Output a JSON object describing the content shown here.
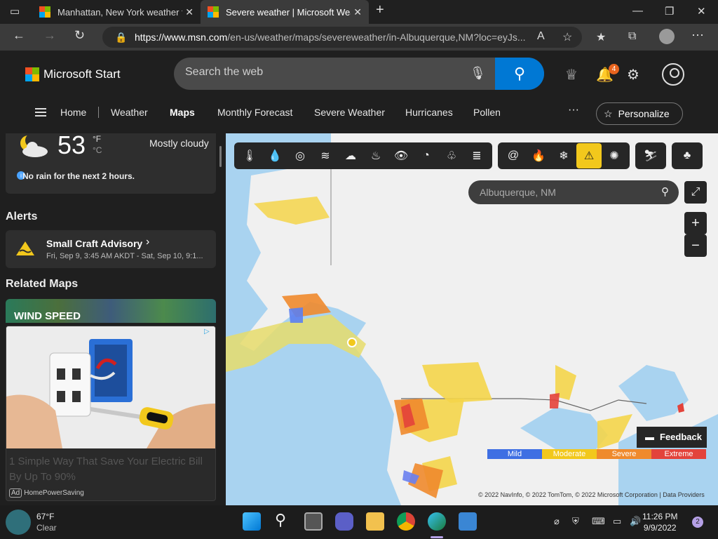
{
  "tabs": [
    {
      "title": "Manhattan, New York weather forecast",
      "close": "✕"
    },
    {
      "title": "Severe weather | Microsoft Weather",
      "close": "✕"
    }
  ],
  "newtab": "+",
  "window": {
    "minimize": "—",
    "maximize": "❐",
    "close": "✕"
  },
  "address": {
    "host": "https://www.msn.com",
    "path": "/en-us/weather/maps/severeweather/in-Albuquerque,NM?loc=eyJs..."
  },
  "site": {
    "brand": "Microsoft Start",
    "search_placeholder": "Search the web",
    "notifications": "4",
    "nav": [
      "Home",
      "Weather",
      "Maps",
      "Monthly Forecast",
      "Severe Weather",
      "Hurricanes",
      "Pollen"
    ],
    "more": "···",
    "personalize": "Personalize"
  },
  "current": {
    "temp": "53",
    "unit_f": "°F",
    "unit_c": "°C",
    "condition": "Mostly cloudy",
    "rain_message": "No rain for the next 2 hours."
  },
  "alerts": {
    "heading": "Alerts",
    "title": "Small Craft Advisory",
    "time": "Fri, Sep 9, 3:45 AM AKDT - Sat, Sep 10, 9:1..."
  },
  "related": {
    "heading": "Related Maps",
    "wind_label": "WIND SPEED"
  },
  "ad": {
    "text": "1 Simple Way That Save Your Electric Bill By Up To 90%",
    "source": "HomePowerSaving",
    "ad_label": "Ad"
  },
  "map": {
    "search_placeholder": "Albuquerque, NM",
    "legend": [
      {
        "label": "Mild",
        "color": "#3e6fe3"
      },
      {
        "label": "Moderate",
        "color": "#f2c81c"
      },
      {
        "label": "Severe",
        "color": "#ef8a2c"
      },
      {
        "label": "Extreme",
        "color": "#e3433b"
      }
    ],
    "feedback": "Feedback",
    "credits": "© 2022 NavInfo, © 2022 TomTom, © 2022 Microsoft Corporation | Data Providers"
  },
  "taskbar": {
    "temp": "67°F",
    "condition": "Clear",
    "time": "11:26 PM",
    "date": "9/9/2022",
    "notifications": "2"
  }
}
